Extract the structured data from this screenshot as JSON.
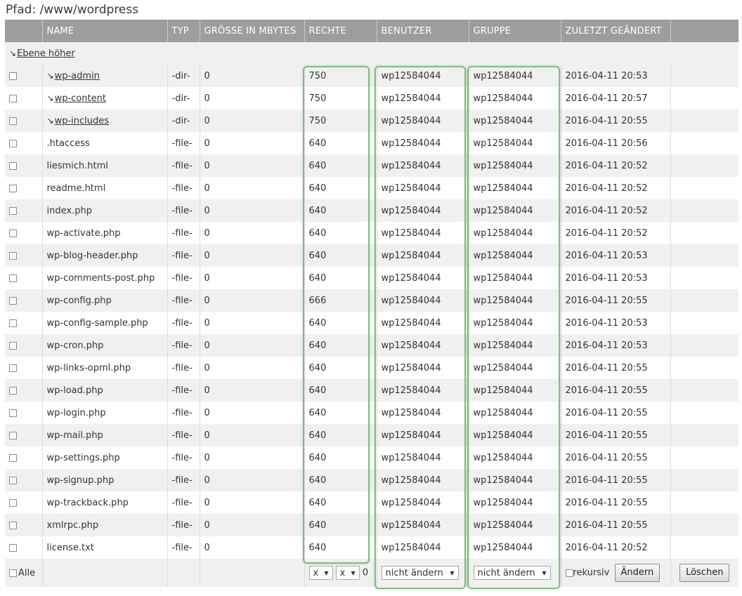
{
  "path_label": "Pfad: /www/wordpress",
  "headers": {
    "name": "NAME",
    "typ": "TYP",
    "size": "GRÖSSE IN MBYTES",
    "rechte": "RECHTE",
    "benutzer": "BENUTZER",
    "gruppe": "GRUPPE",
    "changed": "ZULETZT GEÄNDERT"
  },
  "up_link": "Ebene höher",
  "up_icon": "arrow-down-right-icon",
  "files": [
    {
      "name": "wp-admin",
      "type": "-dir-",
      "size": "0",
      "perm": "750",
      "user": "wp12584044",
      "group": "wp12584044",
      "date": "2016-04-11 20:53",
      "is_dir": true
    },
    {
      "name": "wp-content",
      "type": "-dir-",
      "size": "0",
      "perm": "750",
      "user": "wp12584044",
      "group": "wp12584044",
      "date": "2016-04-11 20:57",
      "is_dir": true
    },
    {
      "name": "wp-includes",
      "type": "-dir-",
      "size": "0",
      "perm": "750",
      "user": "wp12584044",
      "group": "wp12584044",
      "date": "2016-04-11 20:55",
      "is_dir": true
    },
    {
      "name": ".htaccess",
      "type": "-file-",
      "size": "0",
      "perm": "640",
      "user": "wp12584044",
      "group": "wp12584044",
      "date": "2016-04-11 20:56",
      "is_dir": false
    },
    {
      "name": "liesmich.html",
      "type": "-file-",
      "size": "0",
      "perm": "640",
      "user": "wp12584044",
      "group": "wp12584044",
      "date": "2016-04-11 20:52",
      "is_dir": false
    },
    {
      "name": "readme.html",
      "type": "-file-",
      "size": "0",
      "perm": "640",
      "user": "wp12584044",
      "group": "wp12584044",
      "date": "2016-04-11 20:52",
      "is_dir": false
    },
    {
      "name": "index.php",
      "type": "-file-",
      "size": "0",
      "perm": "640",
      "user": "wp12584044",
      "group": "wp12584044",
      "date": "2016-04-11 20:52",
      "is_dir": false
    },
    {
      "name": "wp-activate.php",
      "type": "-file-",
      "size": "0",
      "perm": "640",
      "user": "wp12584044",
      "group": "wp12584044",
      "date": "2016-04-11 20:52",
      "is_dir": false
    },
    {
      "name": "wp-blog-header.php",
      "type": "-file-",
      "size": "0",
      "perm": "640",
      "user": "wp12584044",
      "group": "wp12584044",
      "date": "2016-04-11 20:53",
      "is_dir": false
    },
    {
      "name": "wp-comments-post.php",
      "type": "-file-",
      "size": "0",
      "perm": "640",
      "user": "wp12584044",
      "group": "wp12584044",
      "date": "2016-04-11 20:53",
      "is_dir": false
    },
    {
      "name": "wp-config.php",
      "type": "-file-",
      "size": "0",
      "perm": "666",
      "user": "wp12584044",
      "group": "wp12584044",
      "date": "2016-04-11 20:55",
      "is_dir": false
    },
    {
      "name": "wp-config-sample.php",
      "type": "-file-",
      "size": "0",
      "perm": "640",
      "user": "wp12584044",
      "group": "wp12584044",
      "date": "2016-04-11 20:53",
      "is_dir": false
    },
    {
      "name": "wp-cron.php",
      "type": "-file-",
      "size": "0",
      "perm": "640",
      "user": "wp12584044",
      "group": "wp12584044",
      "date": "2016-04-11 20:53",
      "is_dir": false
    },
    {
      "name": "wp-links-opml.php",
      "type": "-file-",
      "size": "0",
      "perm": "640",
      "user": "wp12584044",
      "group": "wp12584044",
      "date": "2016-04-11 20:55",
      "is_dir": false
    },
    {
      "name": "wp-load.php",
      "type": "-file-",
      "size": "0",
      "perm": "640",
      "user": "wp12584044",
      "group": "wp12584044",
      "date": "2016-04-11 20:55",
      "is_dir": false
    },
    {
      "name": "wp-login.php",
      "type": "-file-",
      "size": "0",
      "perm": "640",
      "user": "wp12584044",
      "group": "wp12584044",
      "date": "2016-04-11 20:55",
      "is_dir": false
    },
    {
      "name": "wp-mail.php",
      "type": "-file-",
      "size": "0",
      "perm": "640",
      "user": "wp12584044",
      "group": "wp12584044",
      "date": "2016-04-11 20:55",
      "is_dir": false
    },
    {
      "name": "wp-settings.php",
      "type": "-file-",
      "size": "0",
      "perm": "640",
      "user": "wp12584044",
      "group": "wp12584044",
      "date": "2016-04-11 20:55",
      "is_dir": false
    },
    {
      "name": "wp-signup.php",
      "type": "-file-",
      "size": "0",
      "perm": "640",
      "user": "wp12584044",
      "group": "wp12584044",
      "date": "2016-04-11 20:55",
      "is_dir": false
    },
    {
      "name": "wp-trackback.php",
      "type": "-file-",
      "size": "0",
      "perm": "640",
      "user": "wp12584044",
      "group": "wp12584044",
      "date": "2016-04-11 20:55",
      "is_dir": false
    },
    {
      "name": "xmlrpc.php",
      "type": "-file-",
      "size": "0",
      "perm": "640",
      "user": "wp12584044",
      "group": "wp12584044",
      "date": "2016-04-11 20:55",
      "is_dir": false
    },
    {
      "name": "license.txt",
      "type": "-file-",
      "size": "0",
      "perm": "640",
      "user": "wp12584044",
      "group": "wp12584044",
      "date": "2016-04-11 20:52",
      "is_dir": false
    }
  ],
  "footer": {
    "all_label": "Alle",
    "perm_select_1": "x",
    "perm_select_2": "x",
    "perm_value": "0",
    "user_select": "nicht ändern",
    "group_select": "nicht ändern",
    "recursive_label": "rekursiv",
    "change_button": "Ändern",
    "delete_button": "Löschen"
  },
  "highlight_color": "#7cbf7c"
}
